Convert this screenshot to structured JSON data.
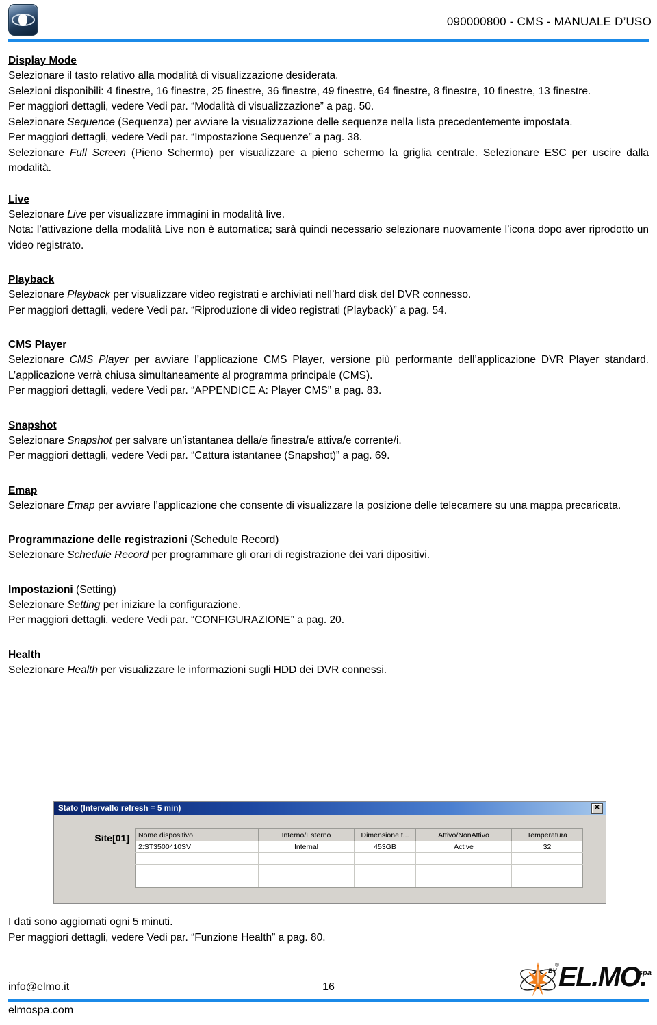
{
  "header": {
    "title": "090000800  -  CMS  -  MANUALE D’USO",
    "logo_icon": "eye-logo-icon",
    "rule_color": "#1b8ae8"
  },
  "sections": [
    {
      "id": "display-mode",
      "heading": "Display Mode",
      "heading_suffix": "",
      "lines": [
        "Selezionare il tasto relativo alla modalità di visualizzazione desiderata.",
        "Selezioni disponibili: 4 finestre, 16 finestre, 25 finestre, 36 finestre, 49 finestre, 64 finestre, 8 finestre, 10 finestre, 13 finestre.",
        "Per maggiori dettagli, vedere Vedi par. “Modalità di visualizzazione” a pag. 50.",
        "Selezionare Sequence (Sequenza) per avviare la visualizzazione delle sequenze nella lista precedentemente impostata.",
        "Per maggiori dettagli, vedere Vedi par. “Impostazione Sequenze” a pag. 38.",
        "Selezionare Full Screen (Pieno Schermo) per visualizzare a pieno schermo la griglia centrale. Selezionare ESC per uscire dalla modalità."
      ]
    },
    {
      "id": "live",
      "heading": "Live",
      "heading_suffix": "",
      "lines": [
        "Selezionare Live per visualizzare immagini in modalità live.",
        "Nota: l’attivazione della modalità Live non è automatica; sarà quindi necessario selezionare nuovamente l’icona dopo aver riprodotto un video registrato."
      ]
    },
    {
      "id": "playback",
      "heading": "Playback",
      "heading_suffix": "",
      "lines": [
        "Selezionare Playback per visualizzare video registrati e archiviati nell’hard disk del DVR connesso.",
        "Per maggiori dettagli, vedere Vedi par. “Riproduzione di video registrati (Playback)” a pag. 54."
      ]
    },
    {
      "id": "cms-player",
      "heading": "CMS Player",
      "heading_suffix": "",
      "lines": [
        "Selezionare CMS Player per avviare l’applicazione CMS Player, versione più performante dell’applicazione DVR Player standard. L’applicazione verrà chiusa simultaneamente al programma principale (CMS).",
        "Per maggiori dettagli, vedere Vedi par. “APPENDICE A: Player CMS” a pag. 83."
      ]
    },
    {
      "id": "snapshot",
      "heading": "Snapshot",
      "heading_suffix": "",
      "lines": [
        "Selezionare Snapshot per salvare un’istantanea della/e finestra/e attiva/e corrente/i.",
        "Per maggiori dettagli, vedere Vedi par. “Cattura istantanee (Snapshot)” a pag. 69."
      ]
    },
    {
      "id": "emap",
      "heading": "Emap",
      "heading_suffix": "",
      "lines": [
        "Selezionare Emap per avviare l’applicazione che consente di visualizzare la posizione delle telecamere su una mappa precaricata."
      ]
    },
    {
      "id": "schedule-record",
      "heading": "Programmazione delle registrazioni",
      "heading_suffix": " (Schedule Record)",
      "lines": [
        "Selezionare Schedule Record per programmare gli orari di registrazione dei vari dipositivi."
      ]
    },
    {
      "id": "impostazioni",
      "heading": "Impostazioni",
      "heading_suffix": " (Setting)",
      "lines": [
        "Selezionare Setting per iniziare la configurazione.",
        "Per maggiori dettagli, vedere Vedi par. “CONFIGURAZIONE” a pag. 20."
      ]
    },
    {
      "id": "health",
      "heading": "Health",
      "heading_suffix": "",
      "lines": [
        "Selezionare Health per visualizzare le informazioni sugli HDD dei DVR connessi."
      ]
    }
  ],
  "dialog": {
    "title": "Stato (Intervallo refresh = 5 min)",
    "close_label": "✕",
    "site_label": "Site[01]",
    "columns": [
      "Nome dispositivo",
      "Interno/Esterno",
      "Dimensione t...",
      "Attivo/NonAttivo",
      "Temperatura"
    ],
    "rows": [
      [
        "2:ST3500410SV",
        "Internal",
        "453GB",
        "Active",
        "32"
      ],
      [
        "",
        "",
        "",
        "",
        ""
      ],
      [
        "",
        "",
        "",
        "",
        ""
      ],
      [
        "",
        "",
        "",
        "",
        ""
      ]
    ]
  },
  "tail": {
    "line1": "I dati sono aggiornati ogni 5 minuti.",
    "line2": "Per maggiori dettagli, vedere Vedi par. “Funzione Health” a pag. 80."
  },
  "footer": {
    "email": "info@elmo.it",
    "page_number": "16",
    "website": "elmospa.com",
    "logo_text": "EL.MO.",
    "logo_suffix": "spa",
    "logo_by": "BY",
    "logo_reg": "®",
    "rule_color": "#1b8ae8",
    "burst_color": "#f07d1a"
  }
}
